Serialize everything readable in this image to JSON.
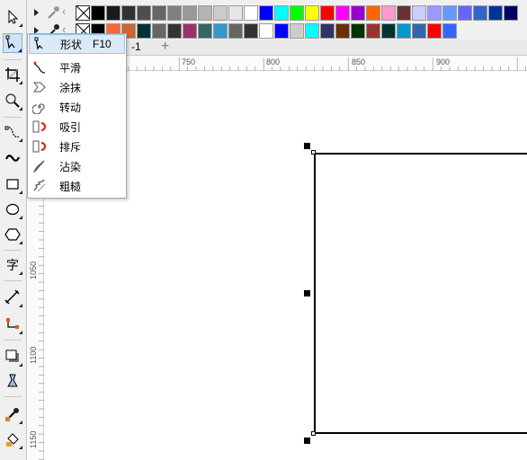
{
  "palette": {
    "row1": [
      "none",
      "#000000",
      "#1a1a1a",
      "#333333",
      "#4d4d4d",
      "#666666",
      "#808080",
      "#999999",
      "#b3b3b3",
      "#cccccc",
      "#e6e6e6",
      "#ffffff",
      "#0000ff",
      "#00ffff",
      "#00ff00",
      "#ffff00",
      "#ff0000",
      "#ff00ff",
      "#9900cc",
      "#ff6600",
      "#ff99cc",
      "#663333",
      "#ccccff",
      "#9999ff",
      "#6699ff",
      "#6666ff",
      "#3366cc",
      "#003399",
      "#000066"
    ],
    "row2": [
      "none",
      "#000000",
      "#ff6633",
      "#cc6633",
      "#003333",
      "#666666",
      "#333333",
      "#993366",
      "#336666",
      "#3399cc",
      "#666666",
      "#333333",
      "#ffffff",
      "#0000ff",
      "#cccccc",
      "#00ffff",
      "#333366",
      "#663300",
      "#003300",
      "#993333",
      "#003333",
      "#0099cc",
      "#3366aa",
      "#ff0000",
      "#3366ff"
    ]
  },
  "document_tab": {
    "label": "-1"
  },
  "rulers": {
    "horizontal": [
      "750",
      "800",
      "850",
      "900"
    ],
    "vertical": [
      "1050",
      "1100",
      "1150"
    ]
  },
  "flyout": {
    "items": [
      {
        "label": "形状",
        "shortcut": "F10",
        "icon": "shape-tool-icon"
      },
      {
        "label": "平滑",
        "icon": "smooth-tool-icon"
      },
      {
        "label": "涂抹",
        "icon": "smear-tool-icon"
      },
      {
        "label": "转动",
        "icon": "twirl-tool-icon"
      },
      {
        "label": "吸引",
        "icon": "attract-tool-icon"
      },
      {
        "label": "排斥",
        "icon": "repel-tool-icon"
      },
      {
        "label": "沾染",
        "icon": "smudge-tool-icon"
      },
      {
        "label": "粗糙",
        "icon": "roughen-tool-icon"
      }
    ]
  },
  "toolbox": {
    "text_tool_glyph": "字"
  }
}
